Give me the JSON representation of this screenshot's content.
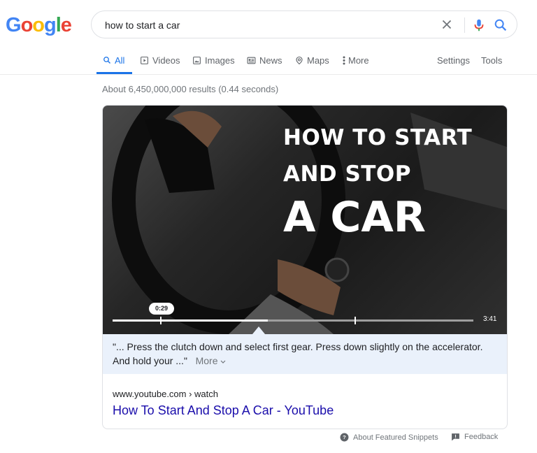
{
  "logo": {
    "letters": [
      "G",
      "o",
      "o",
      "g",
      "l",
      "e"
    ],
    "colors": [
      "#4285f4",
      "#ea4335",
      "#fbbc05",
      "#4285f4",
      "#34a853",
      "#ea4335"
    ]
  },
  "search": {
    "query": "how to start a car"
  },
  "tabs": [
    {
      "label": "All",
      "icon": "search-icon"
    },
    {
      "label": "Videos",
      "icon": "video-icon"
    },
    {
      "label": "Images",
      "icon": "image-icon"
    },
    {
      "label": "News",
      "icon": "news-icon"
    },
    {
      "label": "Maps",
      "icon": "map-pin-icon"
    },
    {
      "label": "More",
      "icon": "more-vert-icon"
    },
    {
      "label": "Settings"
    },
    {
      "label": "Tools"
    }
  ],
  "stats": "About 6,450,000,000 results (0.44 seconds)",
  "video": {
    "title_lines": [
      "HOW TO START",
      "AND STOP",
      "A CAR"
    ],
    "current_time": "0:29",
    "duration": "3:41",
    "played_fraction": 0.43
  },
  "snippet": {
    "line1": "\"... Press the clutch down and select first gear. Press down slightly on the accelerator.",
    "line2": "And hold your ...\"",
    "more_label": "More"
  },
  "result": {
    "source": "www.youtube.com › watch",
    "title": "How To Start And Stop A Car - YouTube"
  },
  "footer": {
    "about_label": "About Featured Snippets",
    "feedback_label": "Feedback"
  },
  "colors": {
    "link": "#1a0dab",
    "accent": "#1a73e8",
    "snippet_bg": "#eaf1fb"
  }
}
